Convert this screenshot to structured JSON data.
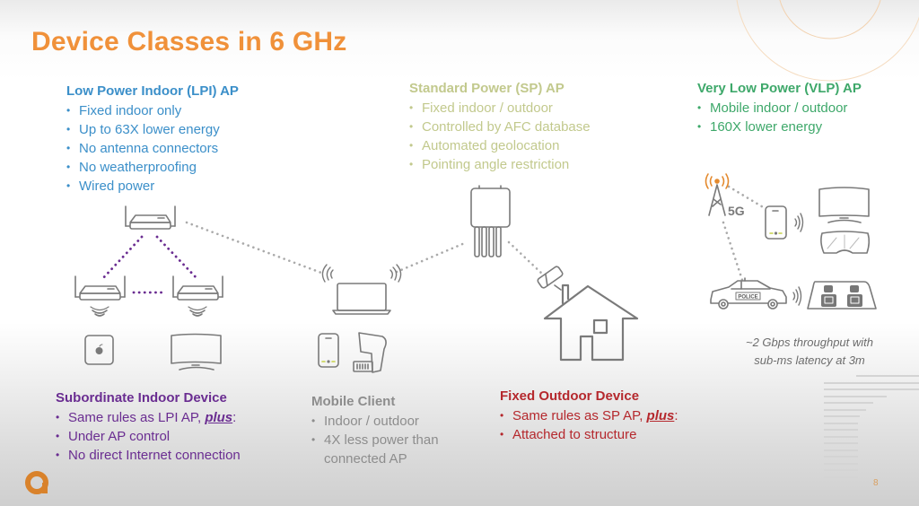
{
  "slide": {
    "title": "Device Classes in 6 GHz",
    "page_number": "8",
    "colors": {
      "title": "#f0913a",
      "lpi": "#3b8fc9",
      "sp": "#c2c98d",
      "vlp": "#3ea86a",
      "subordinate": "#6a2d91",
      "mobile_client": "#8d8d8d",
      "fixed_outdoor": "#b5282d",
      "logo": "#d9822b"
    }
  },
  "lpi": {
    "heading": "Low Power Indoor (LPI) AP",
    "bullets": [
      "Fixed indoor only",
      "Up to 63X lower energy",
      "No antenna connectors",
      "No weatherproofing",
      "Wired power"
    ]
  },
  "sp": {
    "heading": "Standard Power (SP) AP",
    "bullets": [
      "Fixed indoor / outdoor",
      "Controlled by AFC database",
      "Automated geolocation",
      "Pointing angle restriction"
    ]
  },
  "vlp": {
    "heading": "Very Low Power (VLP) AP",
    "bullets": [
      "Mobile indoor / outdoor",
      "160X lower energy"
    ],
    "cell_label": "5G",
    "police_label": "POLICE",
    "note_line1": "~2 Gbps throughput with",
    "note_line2": "sub-ms latency at 3m"
  },
  "subordinate": {
    "heading": "Subordinate Indoor Device",
    "bullet1_prefix": "Same rules as LPI AP, ",
    "bullet1_emph": "plus",
    "bullet1_suffix": ":",
    "bullets": [
      "Under AP control",
      "No direct Internet connection"
    ]
  },
  "mobile_client": {
    "heading": "Mobile Client",
    "bullets": [
      "Indoor / outdoor",
      "4X less power than"
    ],
    "continuation": "connected AP"
  },
  "fixed_outdoor": {
    "heading": "Fixed Outdoor Device",
    "bullet1_prefix": "Same rules as SP AP, ",
    "bullet1_emph": "plus",
    "bullet1_suffix": ":",
    "bullets": [
      "Attached to structure"
    ]
  },
  "icons": [
    "lpi-router-icon",
    "subordinate-router-icon",
    "wifi-signal-icon",
    "apple-mac-mini-icon",
    "tv-monitor-icon",
    "laptop-icon",
    "smartphone-icon",
    "barcode-scanner-icon",
    "outdoor-ap-icon",
    "antenna-panel-icon",
    "house-icon",
    "cell-tower-icon",
    "vr-headset-icon",
    "police-car-icon",
    "car-seats-screens-icon",
    "logo-icon"
  ]
}
